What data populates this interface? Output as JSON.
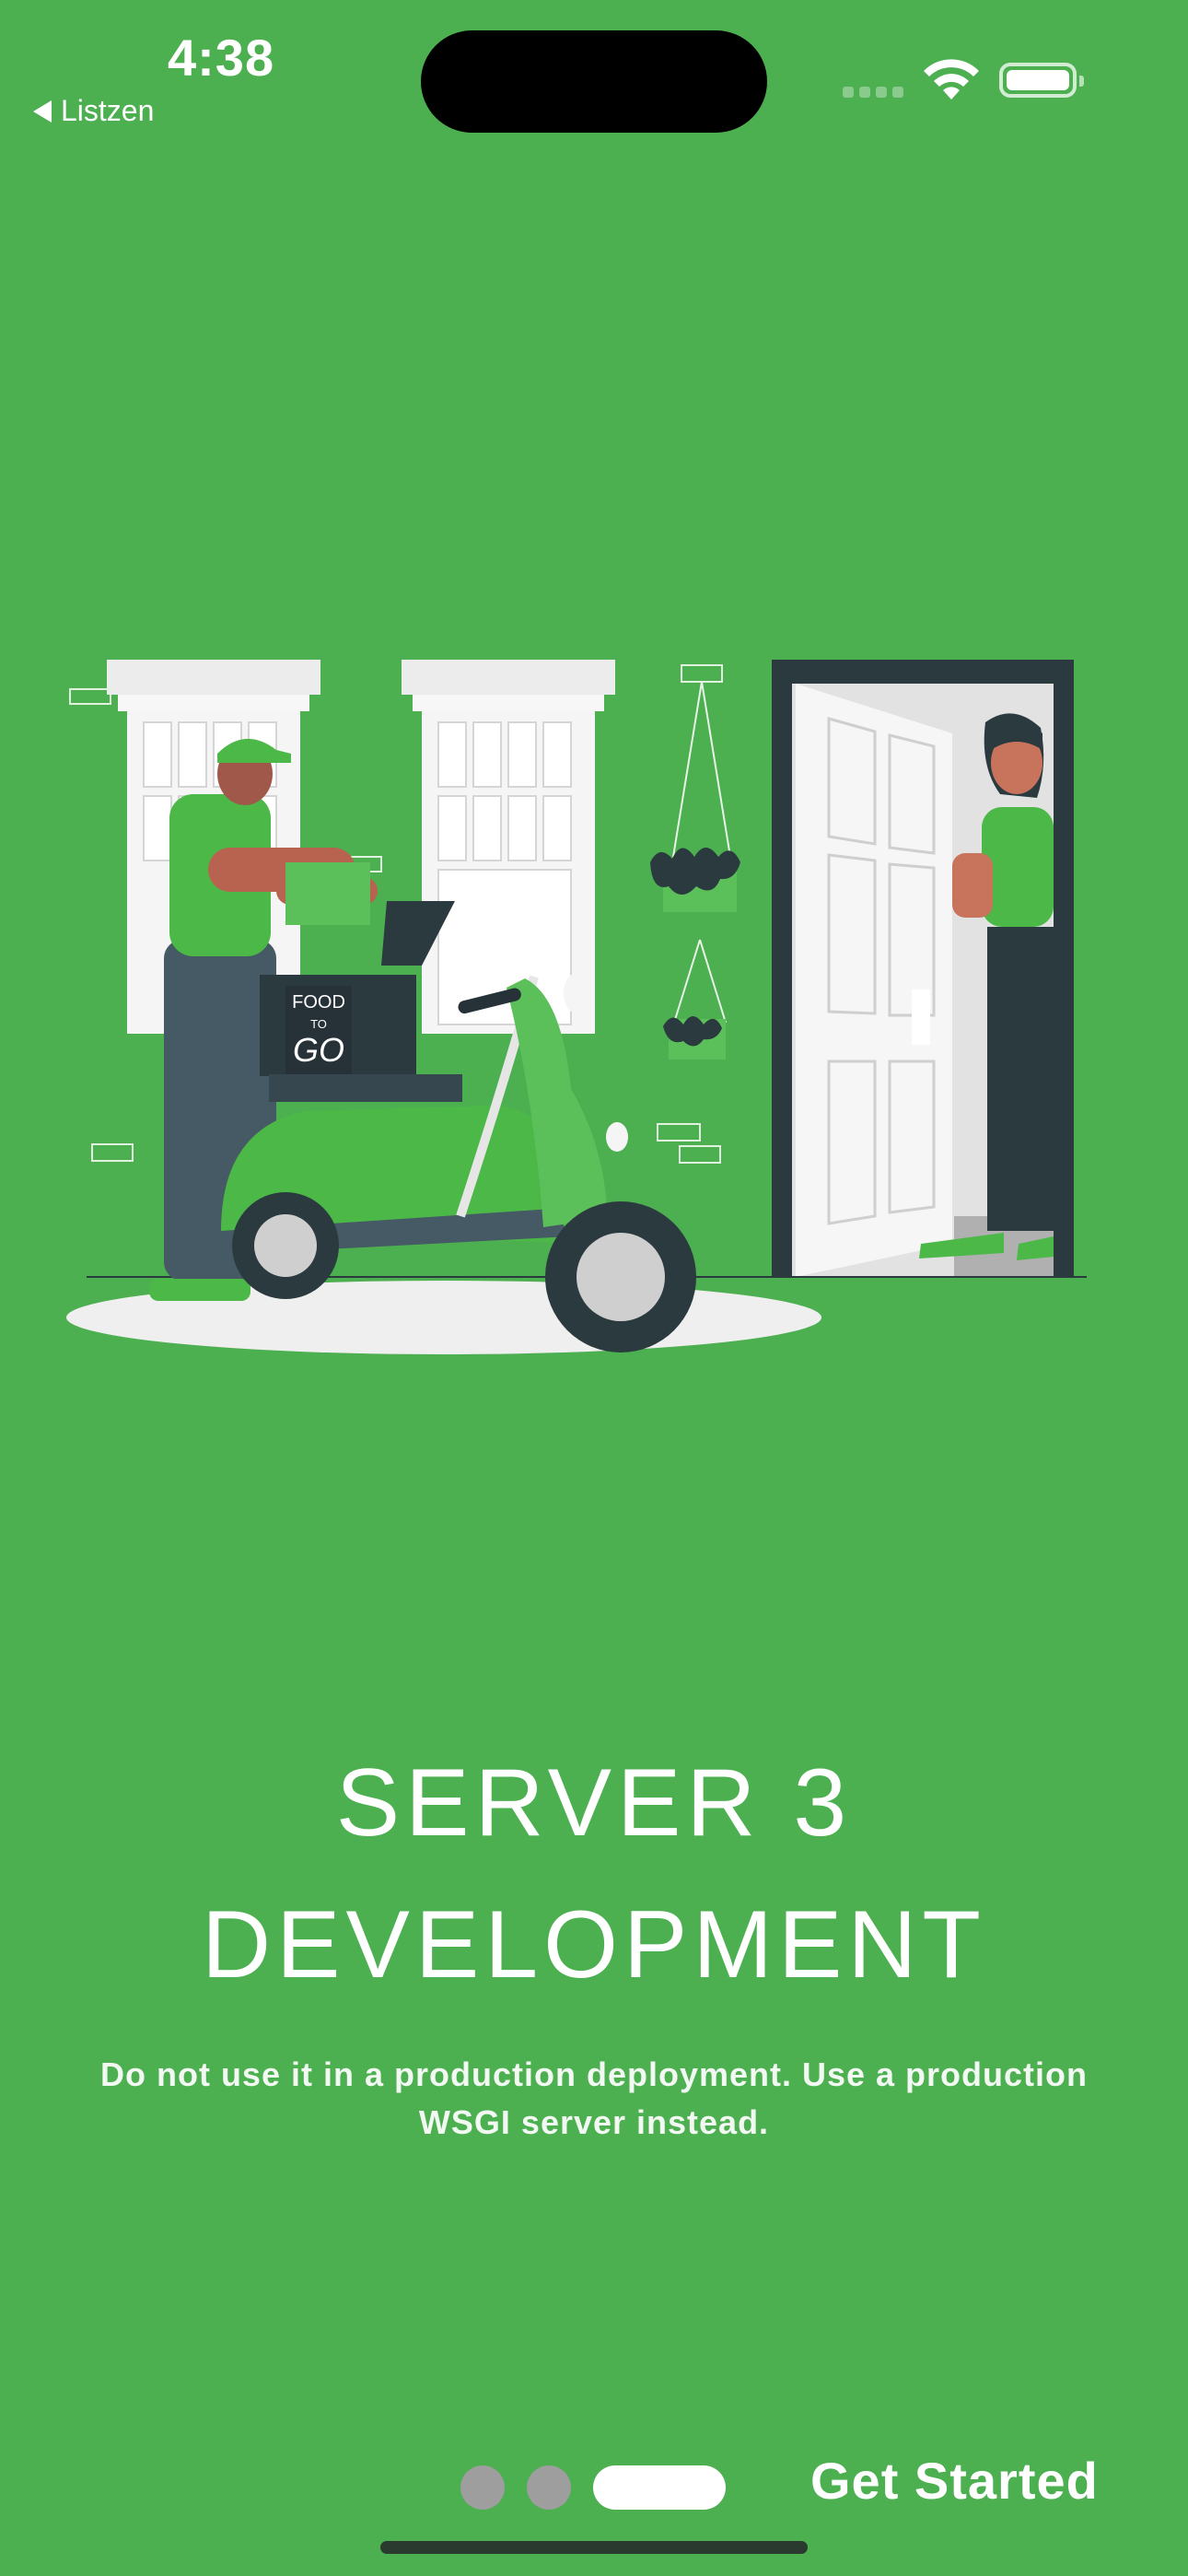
{
  "status_bar": {
    "time": "4:38",
    "back_label": "Listzen"
  },
  "illustration": {
    "box_line1": "FOOD",
    "box_line2": "TO",
    "box_line3": "GO"
  },
  "onboarding": {
    "title_line1": "SERVER 3",
    "title_line2": "DEVELOPMENT",
    "description": "Do not use it in a production deployment. Use a production WSGI server instead.",
    "page_count": 3,
    "active_page": 3,
    "cta_label": "Get Started"
  },
  "colors": {
    "background": "#4caf50",
    "accent": "#4cb848",
    "dark": "#2b3a3f",
    "inactive_dot": "#9e9e9e"
  }
}
